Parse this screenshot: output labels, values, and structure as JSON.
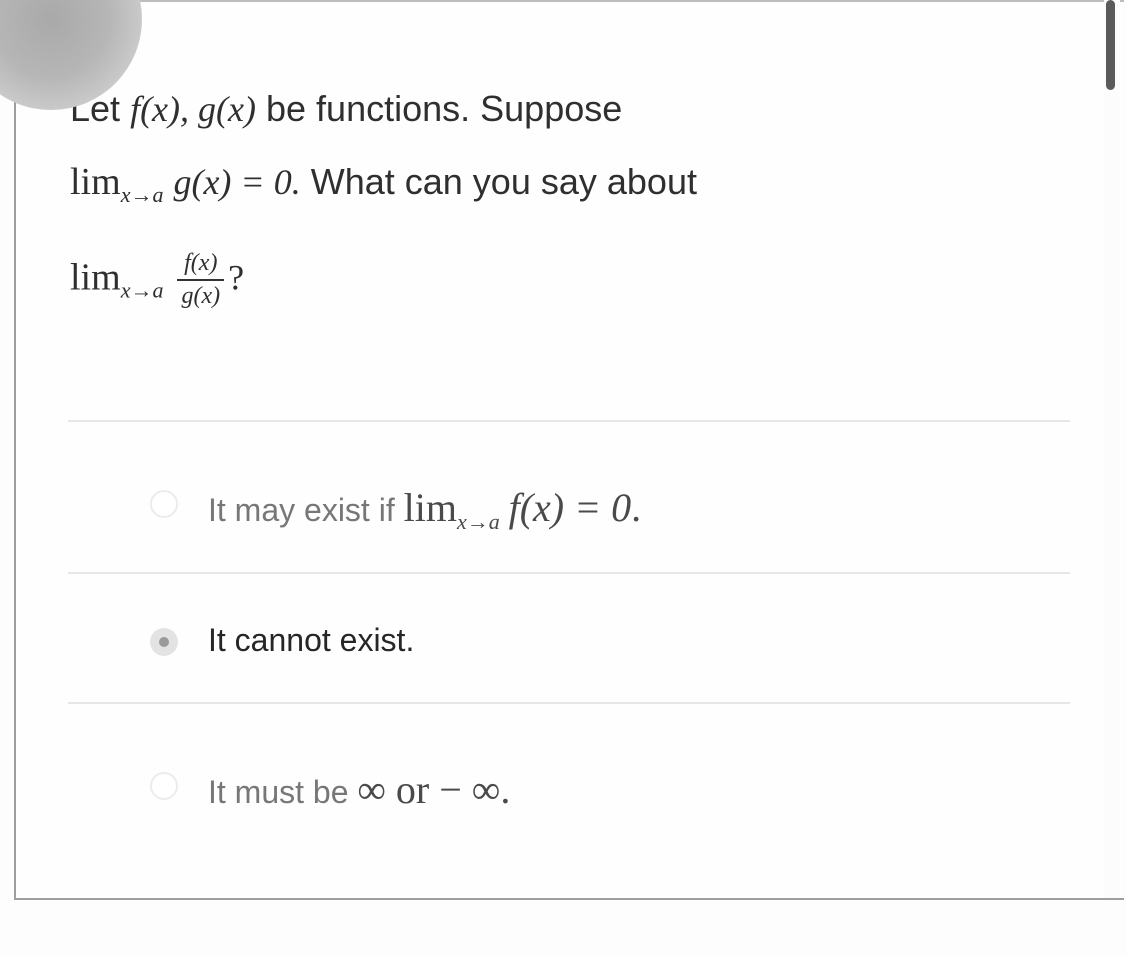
{
  "question": {
    "line1": {
      "prefix": "Let",
      "math": "f(x), g(x)",
      "suffix": "be functions. Suppose"
    },
    "line2": {
      "lim": "lim",
      "sub": "x→a",
      "math": "g(x) = 0.",
      "suffix": "What can you say about"
    },
    "line3": {
      "lim": "lim",
      "sub": "x→a",
      "numerator": "f(x)",
      "denominator": "g(x)",
      "suffix": "?"
    }
  },
  "options": [
    {
      "text": "It may exist if",
      "lim": "lim",
      "sub": "x→a",
      "math": "f(x) = 0",
      "end": ".",
      "selected": false
    },
    {
      "text": "It cannot exist.",
      "selected": true
    },
    {
      "text": "It must be",
      "math": "∞ or  − ∞",
      "end": ".",
      "selected": false
    }
  ],
  "colors": {
    "text": "#2f2f2f",
    "muted": "#777777",
    "divider": "#e6e6e6",
    "scroll_thumb": "#5b5b5b"
  }
}
